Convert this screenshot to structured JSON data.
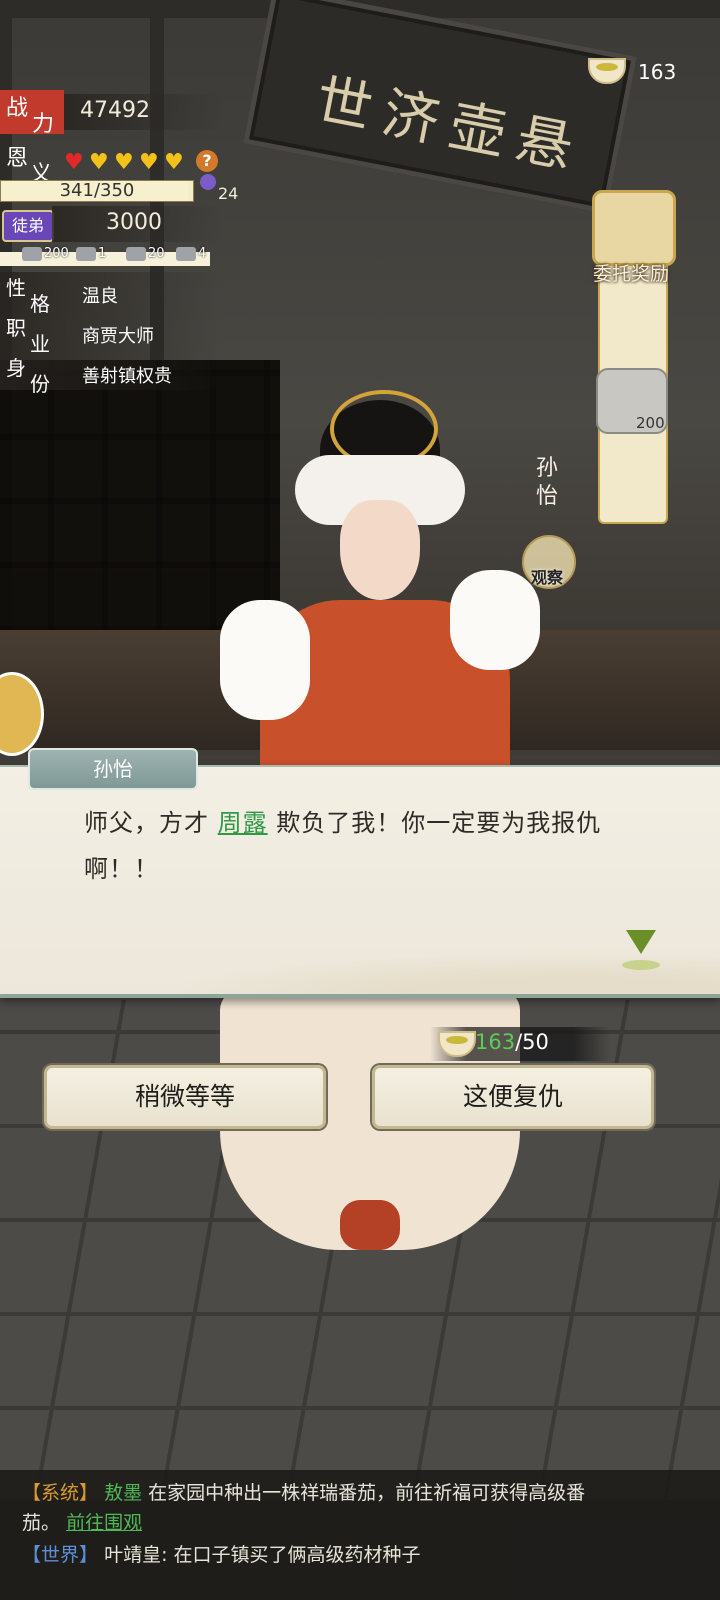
{
  "top_bar": {
    "bowl_count": "163"
  },
  "stats": {
    "power_label_1": "战",
    "power_label_2": "力",
    "power_value": "47492",
    "favor_label_1": "恩",
    "favor_label_2": "义",
    "favor_hearts_red": 1,
    "favor_hearts_gold": 4,
    "favor_help": "?",
    "favor_progress_text": "341/350",
    "favor_progress_fraction": 0.974,
    "gem_count": "24",
    "apprentice_badge": "徒弟",
    "apprentice_value": "3000",
    "resources": [
      "200",
      "1",
      "20",
      "4"
    ],
    "traits": [
      {
        "label_1": "性",
        "label_2": "格",
        "value": "温良"
      },
      {
        "label_1": "职",
        "label_2": "业",
        "value": "商贾大师"
      },
      {
        "label_1": "身",
        "label_2": "份",
        "value": "善射镇权贵"
      }
    ]
  },
  "scene": {
    "plaque_text": "世济壶悬"
  },
  "reward": {
    "title": "委托奖励",
    "silver_count": "200"
  },
  "character": {
    "vertical_name": [
      "孙",
      "怡"
    ],
    "observe_label": "观察"
  },
  "dialog": {
    "speaker": "孙怡",
    "text_before": "师父，方才 ",
    "highlight_name": "周露",
    "text_after": " 欺负了我！你一定要为我报仇啊！！"
  },
  "cost": {
    "have": "163",
    "need": "/50"
  },
  "choices": {
    "wait_label": "稍微等等",
    "revenge_label": "这便复仇"
  },
  "chat": {
    "line1_channel": "【系统】",
    "line1_name": "敖墨",
    "line1_text": "在家园中种出一株祥瑞番茄，前往祈福可获得高级番",
    "line2_text": "茄。",
    "line2_link": "前往围观",
    "line3_channel": "【世界】",
    "line3_text": "叶靖皇: 在口子镇买了俩高级药材种子"
  },
  "colors": {
    "accent_red": "#c23a2b",
    "highlight_green": "#2f9a45",
    "apprentice_purple": "#6a47b8",
    "system_orange": "#d99a2f",
    "world_blue": "#5b8fd6"
  }
}
